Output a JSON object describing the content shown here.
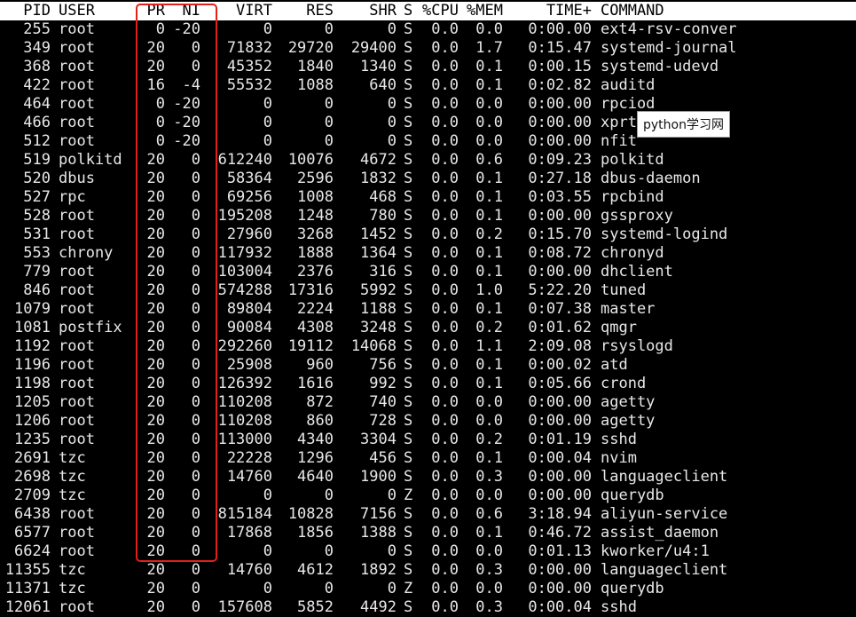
{
  "header": {
    "pid": "PID",
    "user": "USER",
    "pr": "PR",
    "ni": "NI",
    "virt": "VIRT",
    "res": "RES",
    "shr": "SHR",
    "s": "S",
    "cpu": "%CPU",
    "mem": "%MEM",
    "time": "TIME+",
    "command": "COMMAND"
  },
  "processes": [
    {
      "pid": "255",
      "user": "root",
      "pr": "0",
      "ni": "-20",
      "virt": "0",
      "res": "0",
      "shr": "0",
      "s": "S",
      "cpu": "0.0",
      "mem": "0.0",
      "time": "0:00.00",
      "command": "ext4-rsv-conver"
    },
    {
      "pid": "349",
      "user": "root",
      "pr": "20",
      "ni": "0",
      "virt": "71832",
      "res": "29720",
      "shr": "29400",
      "s": "S",
      "cpu": "0.0",
      "mem": "1.7",
      "time": "0:15.47",
      "command": "systemd-journal"
    },
    {
      "pid": "368",
      "user": "root",
      "pr": "20",
      "ni": "0",
      "virt": "45352",
      "res": "1840",
      "shr": "1340",
      "s": "S",
      "cpu": "0.0",
      "mem": "0.1",
      "time": "0:00.15",
      "command": "systemd-udevd"
    },
    {
      "pid": "422",
      "user": "root",
      "pr": "16",
      "ni": "-4",
      "virt": "55532",
      "res": "1088",
      "shr": "640",
      "s": "S",
      "cpu": "0.0",
      "mem": "0.1",
      "time": "0:02.82",
      "command": "auditd"
    },
    {
      "pid": "464",
      "user": "root",
      "pr": "0",
      "ni": "-20",
      "virt": "0",
      "res": "0",
      "shr": "0",
      "s": "S",
      "cpu": "0.0",
      "mem": "0.0",
      "time": "0:00.00",
      "command": "rpciod"
    },
    {
      "pid": "466",
      "user": "root",
      "pr": "0",
      "ni": "-20",
      "virt": "0",
      "res": "0",
      "shr": "0",
      "s": "S",
      "cpu": "0.0",
      "mem": "0.0",
      "time": "0:00.00",
      "command": "xprt"
    },
    {
      "pid": "512",
      "user": "root",
      "pr": "0",
      "ni": "-20",
      "virt": "0",
      "res": "0",
      "shr": "0",
      "s": "S",
      "cpu": "0.0",
      "mem": "0.0",
      "time": "0:00.00",
      "command": "nfit"
    },
    {
      "pid": "519",
      "user": "polkitd",
      "pr": "20",
      "ni": "0",
      "virt": "612240",
      "res": "10076",
      "shr": "4672",
      "s": "S",
      "cpu": "0.0",
      "mem": "0.6",
      "time": "0:09.23",
      "command": "polkitd"
    },
    {
      "pid": "520",
      "user": "dbus",
      "pr": "20",
      "ni": "0",
      "virt": "58364",
      "res": "2596",
      "shr": "1832",
      "s": "S",
      "cpu": "0.0",
      "mem": "0.1",
      "time": "0:27.18",
      "command": "dbus-daemon"
    },
    {
      "pid": "527",
      "user": "rpc",
      "pr": "20",
      "ni": "0",
      "virt": "69256",
      "res": "1008",
      "shr": "468",
      "s": "S",
      "cpu": "0.0",
      "mem": "0.1",
      "time": "0:03.55",
      "command": "rpcbind"
    },
    {
      "pid": "528",
      "user": "root",
      "pr": "20",
      "ni": "0",
      "virt": "195208",
      "res": "1248",
      "shr": "780",
      "s": "S",
      "cpu": "0.0",
      "mem": "0.1",
      "time": "0:00.00",
      "command": "gssproxy"
    },
    {
      "pid": "531",
      "user": "root",
      "pr": "20",
      "ni": "0",
      "virt": "27960",
      "res": "3268",
      "shr": "1452",
      "s": "S",
      "cpu": "0.0",
      "mem": "0.2",
      "time": "0:15.70",
      "command": "systemd-logind"
    },
    {
      "pid": "553",
      "user": "chrony",
      "pr": "20",
      "ni": "0",
      "virt": "117932",
      "res": "1888",
      "shr": "1364",
      "s": "S",
      "cpu": "0.0",
      "mem": "0.1",
      "time": "0:08.72",
      "command": "chronyd"
    },
    {
      "pid": "779",
      "user": "root",
      "pr": "20",
      "ni": "0",
      "virt": "103004",
      "res": "2376",
      "shr": "316",
      "s": "S",
      "cpu": "0.0",
      "mem": "0.1",
      "time": "0:00.00",
      "command": "dhclient"
    },
    {
      "pid": "846",
      "user": "root",
      "pr": "20",
      "ni": "0",
      "virt": "574288",
      "res": "17316",
      "shr": "5992",
      "s": "S",
      "cpu": "0.0",
      "mem": "1.0",
      "time": "5:22.20",
      "command": "tuned"
    },
    {
      "pid": "1079",
      "user": "root",
      "pr": "20",
      "ni": "0",
      "virt": "89804",
      "res": "2224",
      "shr": "1188",
      "s": "S",
      "cpu": "0.0",
      "mem": "0.1",
      "time": "0:07.38",
      "command": "master"
    },
    {
      "pid": "1081",
      "user": "postfix",
      "pr": "20",
      "ni": "0",
      "virt": "90084",
      "res": "4308",
      "shr": "3248",
      "s": "S",
      "cpu": "0.0",
      "mem": "0.2",
      "time": "0:01.62",
      "command": "qmgr"
    },
    {
      "pid": "1192",
      "user": "root",
      "pr": "20",
      "ni": "0",
      "virt": "292260",
      "res": "19112",
      "shr": "14068",
      "s": "S",
      "cpu": "0.0",
      "mem": "1.1",
      "time": "2:09.08",
      "command": "rsyslogd"
    },
    {
      "pid": "1196",
      "user": "root",
      "pr": "20",
      "ni": "0",
      "virt": "25908",
      "res": "960",
      "shr": "756",
      "s": "S",
      "cpu": "0.0",
      "mem": "0.1",
      "time": "0:00.02",
      "command": "atd"
    },
    {
      "pid": "1198",
      "user": "root",
      "pr": "20",
      "ni": "0",
      "virt": "126392",
      "res": "1616",
      "shr": "992",
      "s": "S",
      "cpu": "0.0",
      "mem": "0.1",
      "time": "0:05.66",
      "command": "crond"
    },
    {
      "pid": "1205",
      "user": "root",
      "pr": "20",
      "ni": "0",
      "virt": "110208",
      "res": "872",
      "shr": "740",
      "s": "S",
      "cpu": "0.0",
      "mem": "0.0",
      "time": "0:00.00",
      "command": "agetty"
    },
    {
      "pid": "1206",
      "user": "root",
      "pr": "20",
      "ni": "0",
      "virt": "110208",
      "res": "860",
      "shr": "728",
      "s": "S",
      "cpu": "0.0",
      "mem": "0.0",
      "time": "0:00.00",
      "command": "agetty"
    },
    {
      "pid": "1235",
      "user": "root",
      "pr": "20",
      "ni": "0",
      "virt": "113000",
      "res": "4340",
      "shr": "3304",
      "s": "S",
      "cpu": "0.0",
      "mem": "0.2",
      "time": "0:01.19",
      "command": "sshd"
    },
    {
      "pid": "2691",
      "user": "tzc",
      "pr": "20",
      "ni": "0",
      "virt": "22228",
      "res": "1296",
      "shr": "456",
      "s": "S",
      "cpu": "0.0",
      "mem": "0.1",
      "time": "0:00.04",
      "command": "nvim"
    },
    {
      "pid": "2698",
      "user": "tzc",
      "pr": "20",
      "ni": "0",
      "virt": "14760",
      "res": "4640",
      "shr": "1900",
      "s": "S",
      "cpu": "0.0",
      "mem": "0.3",
      "time": "0:00.00",
      "command": "languageclient"
    },
    {
      "pid": "2709",
      "user": "tzc",
      "pr": "20",
      "ni": "0",
      "virt": "0",
      "res": "0",
      "shr": "0",
      "s": "Z",
      "cpu": "0.0",
      "mem": "0.0",
      "time": "0:00.00",
      "command": "querydb"
    },
    {
      "pid": "6438",
      "user": "root",
      "pr": "20",
      "ni": "0",
      "virt": "815184",
      "res": "10828",
      "shr": "7156",
      "s": "S",
      "cpu": "0.0",
      "mem": "0.6",
      "time": "3:18.94",
      "command": "aliyun-service"
    },
    {
      "pid": "6577",
      "user": "root",
      "pr": "20",
      "ni": "0",
      "virt": "17868",
      "res": "1856",
      "shr": "1388",
      "s": "S",
      "cpu": "0.0",
      "mem": "0.1",
      "time": "0:46.72",
      "command": "assist_daemon"
    },
    {
      "pid": "6624",
      "user": "root",
      "pr": "20",
      "ni": "0",
      "virt": "0",
      "res": "0",
      "shr": "0",
      "s": "S",
      "cpu": "0.0",
      "mem": "0.0",
      "time": "0:01.13",
      "command": "kworker/u4:1"
    },
    {
      "pid": "11355",
      "user": "tzc",
      "pr": "20",
      "ni": "0",
      "virt": "14760",
      "res": "4612",
      "shr": "1892",
      "s": "S",
      "cpu": "0.0",
      "mem": "0.3",
      "time": "0:00.00",
      "command": "languageclient"
    },
    {
      "pid": "11371",
      "user": "tzc",
      "pr": "20",
      "ni": "0",
      "virt": "0",
      "res": "0",
      "shr": "0",
      "s": "Z",
      "cpu": "0.0",
      "mem": "0.0",
      "time": "0:00.00",
      "command": "querydb"
    },
    {
      "pid": "12061",
      "user": "root",
      "pr": "20",
      "ni": "0",
      "virt": "157608",
      "res": "5852",
      "shr": "4492",
      "s": "S",
      "cpu": "0.0",
      "mem": "0.3",
      "time": "0:00.04",
      "command": "sshd"
    }
  ],
  "watermark": "python学习网",
  "colors": {
    "background": "#000000",
    "text": "#e8e8e8",
    "header_bg": "#ffffff",
    "highlight": "#e0201a"
  }
}
